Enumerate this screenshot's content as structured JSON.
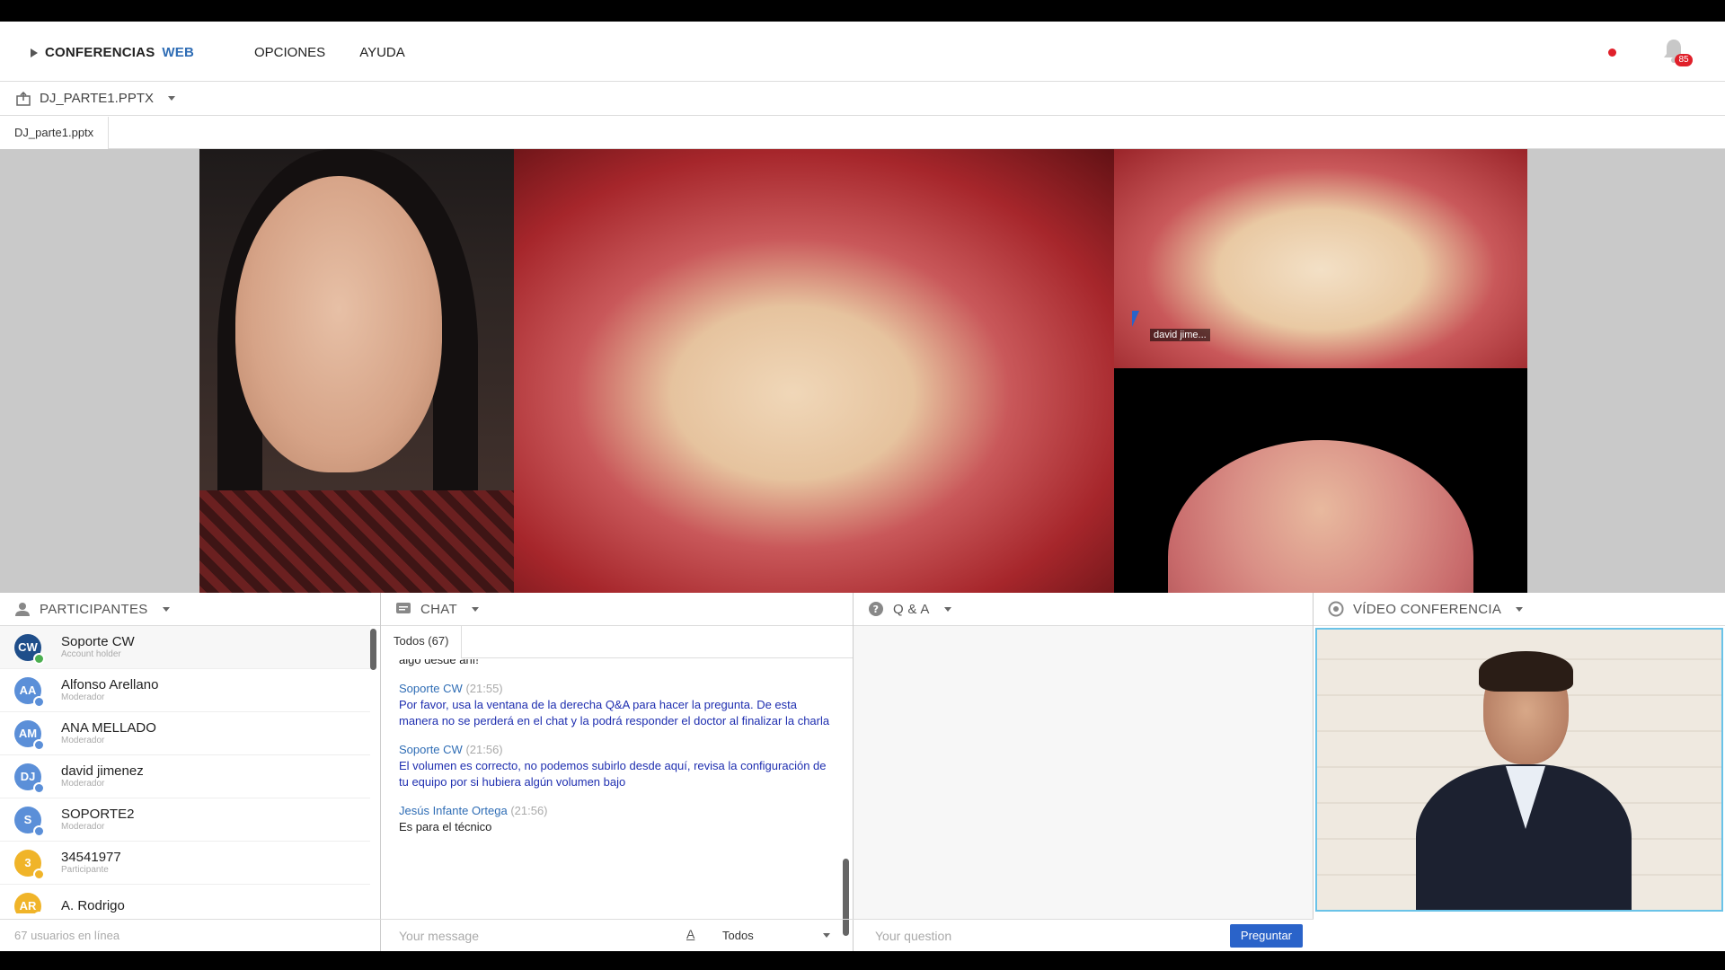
{
  "app": {
    "brand_part1": "CONFERENCIAS",
    "brand_part2": "WEB",
    "menu": [
      "OPCIONES",
      "AYUDA"
    ],
    "notifications_count": "85",
    "colors": {
      "accent": "#2a63c9",
      "brand_blue": "#2f6db5",
      "alert": "#e0202a"
    }
  },
  "document": {
    "title": "DJ_PARTE1.PPTX",
    "tab_label": "DJ_parte1.pptx",
    "cursor_label": "david jime..."
  },
  "participants": {
    "title": "PARTICIPANTES",
    "items": [
      {
        "initials": "CW",
        "name": "Soporte CW",
        "role": "Account holder",
        "color": "#1f4e8a",
        "badge_color": "#4caf50"
      },
      {
        "initials": "AA",
        "name": "Alfonso Arellano",
        "role": "Moderador",
        "color": "#5b8fd8",
        "badge_color": "#5b8fd8"
      },
      {
        "initials": "AM",
        "name": "ANA MELLADO",
        "role": "Moderador",
        "color": "#5b8fd8",
        "badge_color": "#5b8fd8"
      },
      {
        "initials": "DJ",
        "name": "david jimenez",
        "role": "Moderador",
        "color": "#5b8fd8",
        "badge_color": "#5b8fd8"
      },
      {
        "initials": "S",
        "name": "SOPORTE2",
        "role": "Moderador",
        "color": "#5b8fd8",
        "badge_color": "#5b8fd8"
      },
      {
        "initials": "3",
        "name": "34541977",
        "role": "Participante",
        "color": "#f0b429",
        "badge_color": "#f0b429"
      },
      {
        "initials": "AR",
        "name": "A. Rodrigo",
        "role": "",
        "color": "#f0b429",
        "badge_color": "#f0b429"
      }
    ],
    "footer": "67 usuarios en línea"
  },
  "chat": {
    "title": "CHAT",
    "tab_label": "Todos (67)",
    "partial_top": "algo desde ahí!",
    "messages": [
      {
        "author": "Soporte CW",
        "time": "(21:55)",
        "text": "Por favor, usa la ventana de la derecha Q&A para hacer la pregunta. De esta manera no se perderá en el chat y la podrá responder el doctor al finalizar la charla",
        "blue": true
      },
      {
        "author": "Soporte CW",
        "time": "(21:56)",
        "text": "El volumen es correcto, no podemos subirlo desde aquí, revisa la configuración de tu equipo por si hubiera algún volumen bajo",
        "blue": true
      },
      {
        "author": "Jesús Infante Ortega",
        "time": "(21:56)",
        "text": "Es para el técnico",
        "blue": false
      }
    ],
    "input_placeholder": "Your message",
    "format_icon": "A",
    "recipient": "Todos"
  },
  "qa": {
    "title": "Q & A",
    "input_placeholder": "Your question",
    "submit_label": "Preguntar"
  },
  "video": {
    "title": "VÍDEO CONFERENCIA"
  }
}
